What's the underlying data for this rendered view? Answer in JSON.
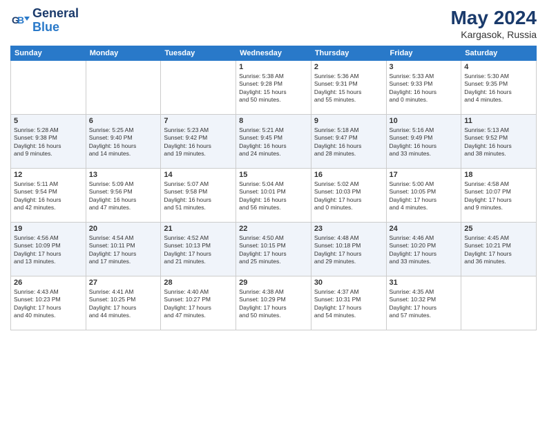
{
  "header": {
    "logo_line1": "General",
    "logo_line2": "Blue",
    "month_year": "May 2024",
    "location": "Kargasok, Russia"
  },
  "weekdays": [
    "Sunday",
    "Monday",
    "Tuesday",
    "Wednesday",
    "Thursday",
    "Friday",
    "Saturday"
  ],
  "weeks": [
    [
      {
        "day": "",
        "info": ""
      },
      {
        "day": "",
        "info": ""
      },
      {
        "day": "",
        "info": ""
      },
      {
        "day": "1",
        "info": "Sunrise: 5:38 AM\nSunset: 9:28 PM\nDaylight: 15 hours\nand 50 minutes."
      },
      {
        "day": "2",
        "info": "Sunrise: 5:36 AM\nSunset: 9:31 PM\nDaylight: 15 hours\nand 55 minutes."
      },
      {
        "day": "3",
        "info": "Sunrise: 5:33 AM\nSunset: 9:33 PM\nDaylight: 16 hours\nand 0 minutes."
      },
      {
        "day": "4",
        "info": "Sunrise: 5:30 AM\nSunset: 9:35 PM\nDaylight: 16 hours\nand 4 minutes."
      }
    ],
    [
      {
        "day": "5",
        "info": "Sunrise: 5:28 AM\nSunset: 9:38 PM\nDaylight: 16 hours\nand 9 minutes."
      },
      {
        "day": "6",
        "info": "Sunrise: 5:25 AM\nSunset: 9:40 PM\nDaylight: 16 hours\nand 14 minutes."
      },
      {
        "day": "7",
        "info": "Sunrise: 5:23 AM\nSunset: 9:42 PM\nDaylight: 16 hours\nand 19 minutes."
      },
      {
        "day": "8",
        "info": "Sunrise: 5:21 AM\nSunset: 9:45 PM\nDaylight: 16 hours\nand 24 minutes."
      },
      {
        "day": "9",
        "info": "Sunrise: 5:18 AM\nSunset: 9:47 PM\nDaylight: 16 hours\nand 28 minutes."
      },
      {
        "day": "10",
        "info": "Sunrise: 5:16 AM\nSunset: 9:49 PM\nDaylight: 16 hours\nand 33 minutes."
      },
      {
        "day": "11",
        "info": "Sunrise: 5:13 AM\nSunset: 9:52 PM\nDaylight: 16 hours\nand 38 minutes."
      }
    ],
    [
      {
        "day": "12",
        "info": "Sunrise: 5:11 AM\nSunset: 9:54 PM\nDaylight: 16 hours\nand 42 minutes."
      },
      {
        "day": "13",
        "info": "Sunrise: 5:09 AM\nSunset: 9:56 PM\nDaylight: 16 hours\nand 47 minutes."
      },
      {
        "day": "14",
        "info": "Sunrise: 5:07 AM\nSunset: 9:58 PM\nDaylight: 16 hours\nand 51 minutes."
      },
      {
        "day": "15",
        "info": "Sunrise: 5:04 AM\nSunset: 10:01 PM\nDaylight: 16 hours\nand 56 minutes."
      },
      {
        "day": "16",
        "info": "Sunrise: 5:02 AM\nSunset: 10:03 PM\nDaylight: 17 hours\nand 0 minutes."
      },
      {
        "day": "17",
        "info": "Sunrise: 5:00 AM\nSunset: 10:05 PM\nDaylight: 17 hours\nand 4 minutes."
      },
      {
        "day": "18",
        "info": "Sunrise: 4:58 AM\nSunset: 10:07 PM\nDaylight: 17 hours\nand 9 minutes."
      }
    ],
    [
      {
        "day": "19",
        "info": "Sunrise: 4:56 AM\nSunset: 10:09 PM\nDaylight: 17 hours\nand 13 minutes."
      },
      {
        "day": "20",
        "info": "Sunrise: 4:54 AM\nSunset: 10:11 PM\nDaylight: 17 hours\nand 17 minutes."
      },
      {
        "day": "21",
        "info": "Sunrise: 4:52 AM\nSunset: 10:13 PM\nDaylight: 17 hours\nand 21 minutes."
      },
      {
        "day": "22",
        "info": "Sunrise: 4:50 AM\nSunset: 10:15 PM\nDaylight: 17 hours\nand 25 minutes."
      },
      {
        "day": "23",
        "info": "Sunrise: 4:48 AM\nSunset: 10:18 PM\nDaylight: 17 hours\nand 29 minutes."
      },
      {
        "day": "24",
        "info": "Sunrise: 4:46 AM\nSunset: 10:20 PM\nDaylight: 17 hours\nand 33 minutes."
      },
      {
        "day": "25",
        "info": "Sunrise: 4:45 AM\nSunset: 10:21 PM\nDaylight: 17 hours\nand 36 minutes."
      }
    ],
    [
      {
        "day": "26",
        "info": "Sunrise: 4:43 AM\nSunset: 10:23 PM\nDaylight: 17 hours\nand 40 minutes."
      },
      {
        "day": "27",
        "info": "Sunrise: 4:41 AM\nSunset: 10:25 PM\nDaylight: 17 hours\nand 44 minutes."
      },
      {
        "day": "28",
        "info": "Sunrise: 4:40 AM\nSunset: 10:27 PM\nDaylight: 17 hours\nand 47 minutes."
      },
      {
        "day": "29",
        "info": "Sunrise: 4:38 AM\nSunset: 10:29 PM\nDaylight: 17 hours\nand 50 minutes."
      },
      {
        "day": "30",
        "info": "Sunrise: 4:37 AM\nSunset: 10:31 PM\nDaylight: 17 hours\nand 54 minutes."
      },
      {
        "day": "31",
        "info": "Sunrise: 4:35 AM\nSunset: 10:32 PM\nDaylight: 17 hours\nand 57 minutes."
      },
      {
        "day": "",
        "info": ""
      }
    ]
  ]
}
